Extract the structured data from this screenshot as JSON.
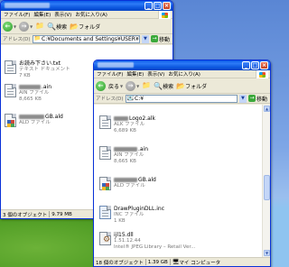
{
  "labels": {
    "menu": [
      "ファイル(F)",
      "編集(E)",
      "表示(V)",
      "お気に入り(A)"
    ],
    "back": "戻る",
    "search": "検索",
    "folder": "フォルダ",
    "address": "アドレス(D)",
    "go": "移動"
  },
  "window1": {
    "address": "C:¥Documents and Settings¥USER¥",
    "files": [
      {
        "name": "お読み下さい.txt",
        "type": "テキスト ドキュメント",
        "size": "7 KB"
      },
      {
        "name_suffix": ".ain",
        "type": "AIN ファイル",
        "size": "8,665 KB"
      },
      {
        "name_suffix": "GB.ald",
        "type": "ALD ファイル",
        "size": ""
      }
    ],
    "status": {
      "objects": "3 個のオブジェクト",
      "size": "9.79 MB"
    }
  },
  "window2": {
    "address": "C:¥",
    "files": [
      {
        "name_suffix": "Logo2.alk",
        "type": "ALK ファイル",
        "size": "6,689 KB"
      },
      {
        "name_suffix": ".ain",
        "type": "AIN ファイル",
        "size": "8,665 KB"
      },
      {
        "name_suffix": "GB.ald",
        "type": "ALD ファイル",
        "size": ""
      },
      {
        "name": "DrawPluginDLL.inc",
        "type": "INC ファイル",
        "size": "1 KB"
      },
      {
        "name": "ijl15.dll",
        "version": "1.51.12.44",
        "description": "Intel® JPEG Library – Retail Ver..."
      }
    ],
    "status": {
      "objects": "18 個のオブジェクト",
      "size": "1.39 GB",
      "location": "マイ コンピュータ"
    }
  },
  "colors": {
    "titlebar": "#0a5ae8",
    "window_bg": "#ece9d8",
    "desktop": "#7ea6e6"
  }
}
